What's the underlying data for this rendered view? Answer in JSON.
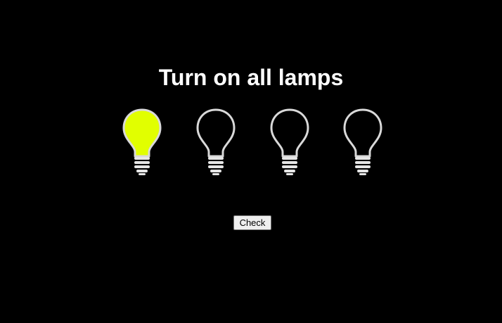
{
  "page": {
    "title": "Turn on all lamps",
    "check_label": "Check"
  },
  "lamps": [
    {
      "name": "lamp-1",
      "on": true
    },
    {
      "name": "lamp-2",
      "on": false
    },
    {
      "name": "lamp-3",
      "on": false
    },
    {
      "name": "lamp-4",
      "on": false
    }
  ],
  "colors": {
    "background": "#000000",
    "lamp_on_fill": "#e1ff00",
    "lamp_off_fill": "#000000",
    "lamp_outline": "#d9d9d9",
    "base_fill": "#e6e6e6"
  },
  "icons": {
    "lamp": "light-bulb-icon"
  }
}
